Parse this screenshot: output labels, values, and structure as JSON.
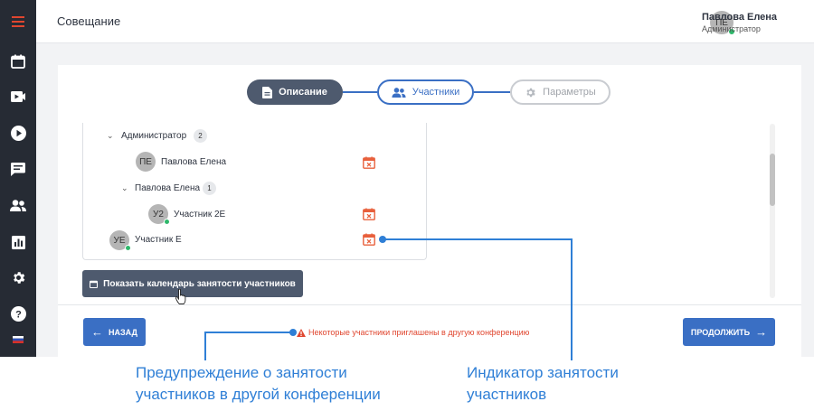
{
  "header": {
    "title": "Совещание",
    "user": {
      "initials": "ПЕ",
      "name": "Павлова Елена",
      "role": "Администратор",
      "status_color": "#2fb86b"
    }
  },
  "sidebar": {
    "items": [
      {
        "name": "menu",
        "icon": "hamburger-menu-icon",
        "color": "#e0462f"
      },
      {
        "name": "calendar",
        "icon": "calendar-icon"
      },
      {
        "name": "video",
        "icon": "video-camera-icon"
      },
      {
        "name": "play",
        "icon": "play-icon"
      },
      {
        "name": "chat",
        "icon": "chat-icon"
      },
      {
        "name": "users",
        "icon": "users-icon"
      },
      {
        "name": "reports",
        "icon": "bar-chart-icon"
      },
      {
        "name": "settings",
        "icon": "gear-icon"
      },
      {
        "name": "help",
        "icon": "help-icon"
      },
      {
        "name": "language",
        "icon": "russian-flag-icon"
      }
    ]
  },
  "steps": [
    {
      "label": "Описание",
      "state": "done",
      "icon": "document-icon"
    },
    {
      "label": "Участники",
      "state": "current",
      "icon": "users-icon"
    },
    {
      "label": "Параметры",
      "state": "disabled",
      "icon": "gear-icon"
    }
  ],
  "tree": {
    "group_admin": {
      "label": "Администратор",
      "count": "2"
    },
    "admin_user": {
      "initials": "ПЕ",
      "name": "Павлова Елена"
    },
    "group_pavlova": {
      "label": "Павлова Елена",
      "count": "1"
    },
    "participant_2e": {
      "initials": "У2",
      "name": "Участник 2Е"
    },
    "participant_e": {
      "initials": "УЕ",
      "name": "Участник Е"
    }
  },
  "buttons": {
    "calendar": "Показать календарь занятости участников",
    "back": "НАЗАД",
    "next": "ПРОДОЛЖИТЬ"
  },
  "warning": "Некоторые участники приглашены в другую конференцию",
  "annotations": {
    "warning_callout": [
      "Предупреждение о занятости",
      "участников в другой конференции"
    ],
    "indicator_callout": [
      "Индикатор занятости",
      "участников"
    ]
  },
  "colors": {
    "accent": "#3a6fc4",
    "dark_button": "#4e5a6e",
    "busy_icon": "#e8603c",
    "warning": "#e0462f",
    "annotation": "#2f7fd6"
  }
}
